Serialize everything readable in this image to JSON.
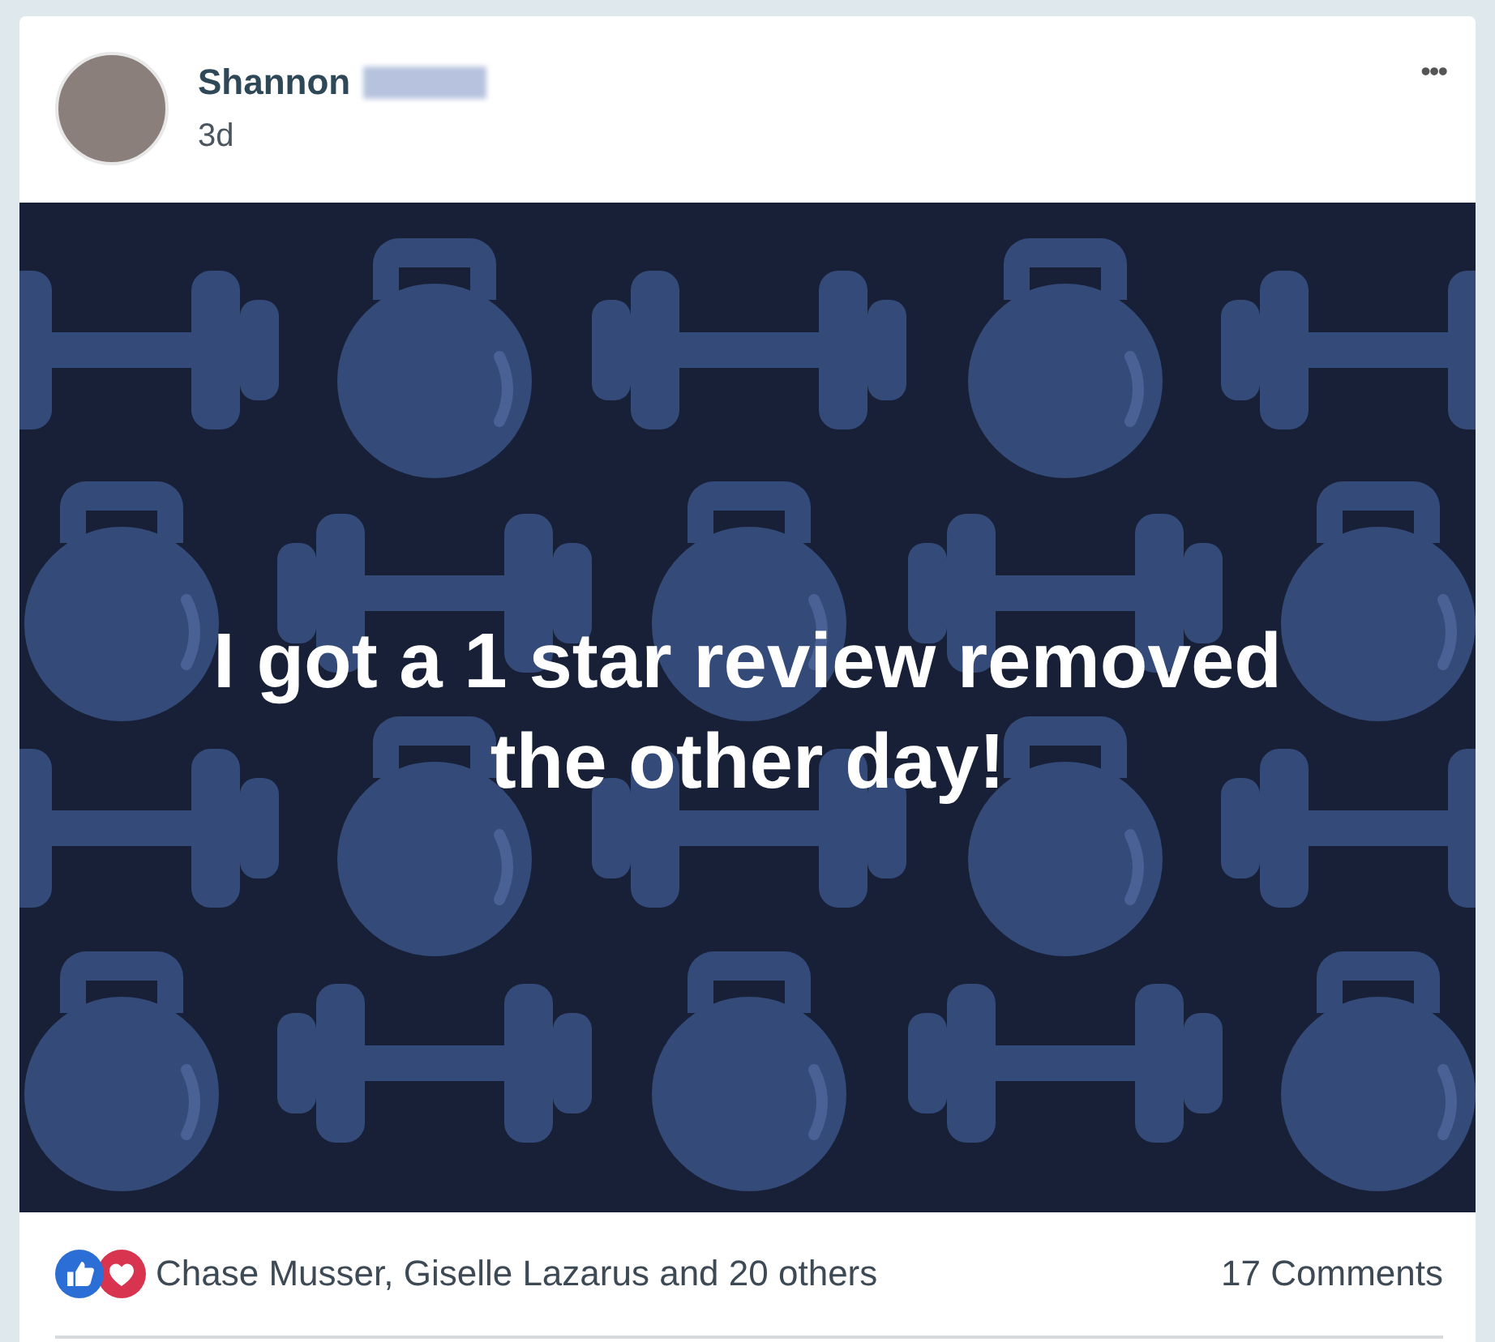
{
  "post": {
    "author": "Shannon",
    "author_redacted": true,
    "time": "3d",
    "menu_icon": "•••"
  },
  "image": {
    "caption": "I got a 1 star review removed the other day!"
  },
  "footer": {
    "reactions": [
      {
        "kind": "like"
      },
      {
        "kind": "love"
      }
    ],
    "reacted_by": "Chase Musser, Giselle Lazarus and 20 others",
    "comments": "17 Comments"
  }
}
